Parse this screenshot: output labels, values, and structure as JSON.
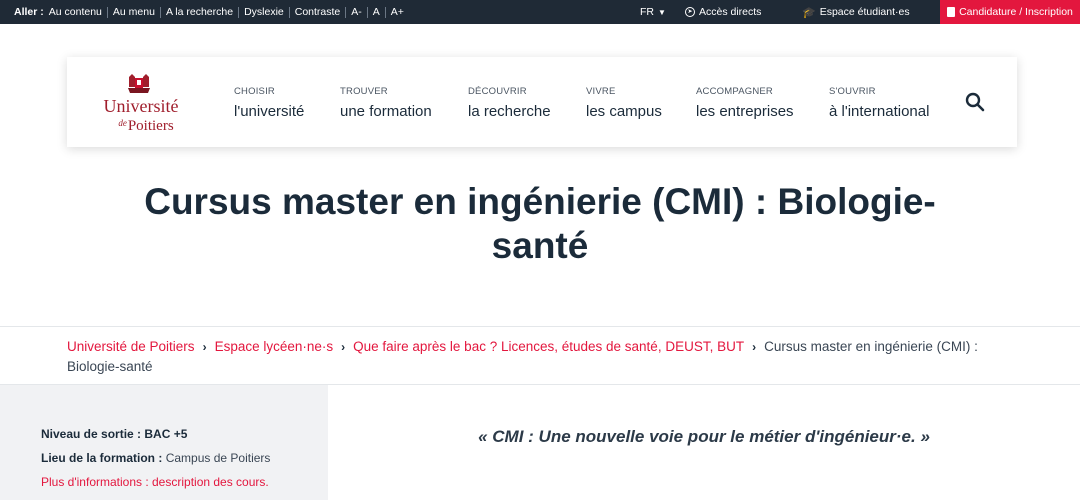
{
  "topbar": {
    "goto_label": "Aller :",
    "links": [
      "Au contenu",
      "Au menu",
      "A la recherche",
      "Dyslexie",
      "Contraste",
      "A-",
      "A",
      "A+"
    ],
    "lang": "FR",
    "direct_access": "Accès directs",
    "student_space": "Espace étudiant·es",
    "cta": "Candidature / Inscription"
  },
  "logo": {
    "line1": "Université",
    "line2_prefix": "de",
    "line2": "Poitiers"
  },
  "nav": [
    {
      "small": "CHOISIR",
      "big": "l'université"
    },
    {
      "small": "TROUVER",
      "big": "une formation"
    },
    {
      "small": "DÉCOUVRIR",
      "big": "la recherche"
    },
    {
      "small": "VIVRE",
      "big": "les campus"
    },
    {
      "small": "ACCOMPAGNER",
      "big": "les entreprises"
    },
    {
      "small": "S'OUVRIR",
      "big": "à l'international"
    }
  ],
  "page_title": "Cursus master en ingénierie (CMI) : Biologie-santé",
  "breadcrumb": {
    "items": [
      "Université de Poitiers",
      "Espace lycéen·ne·s",
      "Que faire après le bac ? Licences, études de santé, DEUST, BUT"
    ],
    "current": "Cursus master en ingénierie (CMI) : Biologie-santé"
  },
  "sidebar": {
    "level_label": "Niveau de sortie :",
    "level_value": "BAC +5",
    "place_label": "Lieu de la formation :",
    "place_value": "Campus de Poitiers",
    "more_info": "Plus d'informations : description des cours."
  },
  "quote": "« CMI : Une nouvelle voie pour le métier d'ingénieur·e. »",
  "colors": {
    "accent": "#e3173e",
    "topbar": "#1f2a36",
    "logo_red": "#a01e2c"
  }
}
